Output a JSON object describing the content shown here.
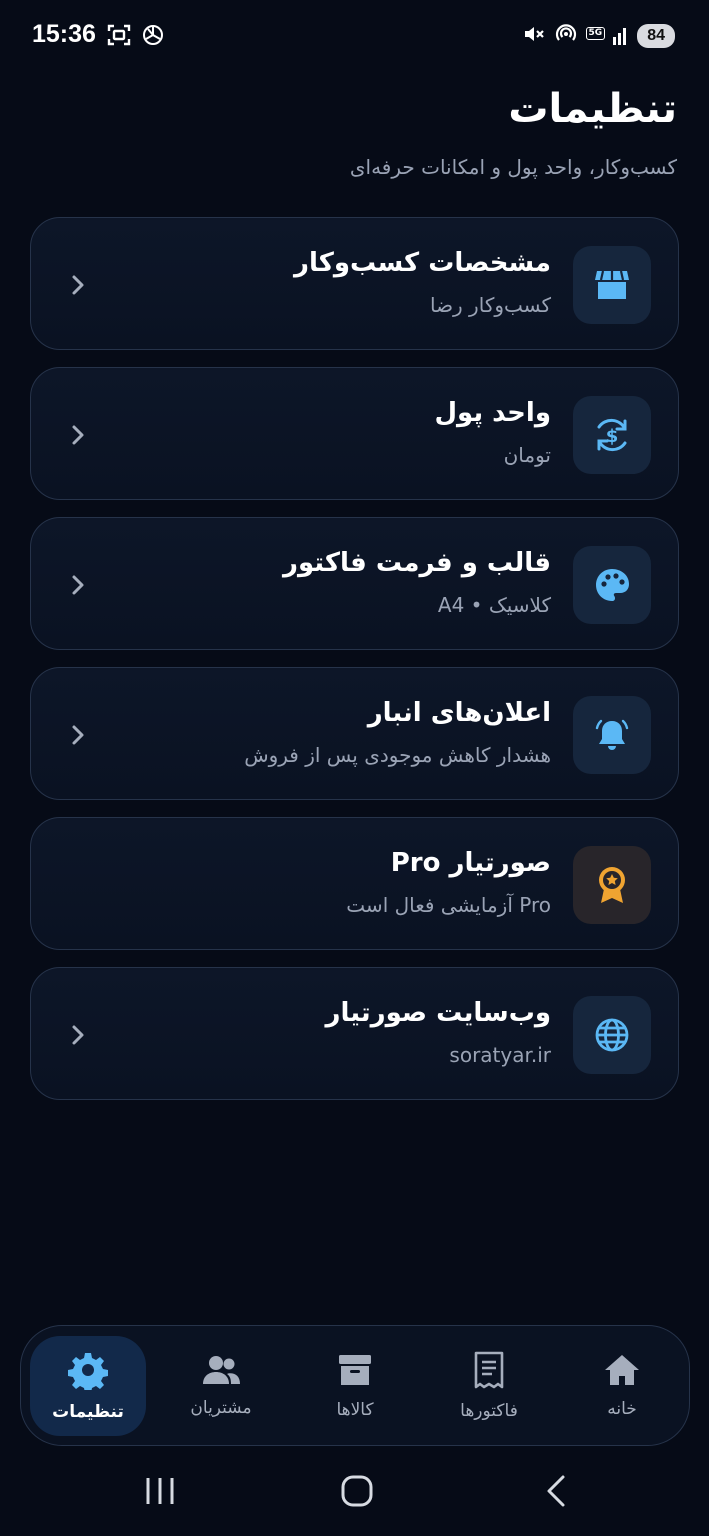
{
  "status_bar": {
    "time": "15:36",
    "battery": "84",
    "network": "5G",
    "icons": [
      "screenshot-icon",
      "chatgpt-icon",
      "mute-icon",
      "hotspot-icon",
      "signal-icon"
    ]
  },
  "header": {
    "title": "تنظیمات",
    "subtitle": "کسب‌وکار، واحد پول و امکانات حرفه‌ای"
  },
  "settings": [
    {
      "title": "مشخصات کسب‌وکار",
      "subtitle": "کسب‌وکار رضا",
      "icon": "store-icon"
    },
    {
      "title": "واحد پول",
      "subtitle": "تومان",
      "icon": "currency-exchange-icon"
    },
    {
      "title": "قالب و فرمت فاکتور",
      "subtitle": "کلاسیک • A4",
      "icon": "palette-icon"
    },
    {
      "title": "اعلان‌های انبار",
      "subtitle": "هشدار کاهش موجودی پس از فروش",
      "icon": "bell-icon"
    },
    {
      "title": "صورتیار Pro",
      "subtitle": "Pro آزمایشی فعال است",
      "icon": "award-icon"
    },
    {
      "title": "وب‌سایت صورتیار",
      "subtitle": "soratyar.ir",
      "icon": "globe-icon"
    }
  ],
  "bottom_nav": {
    "items": [
      {
        "label": "تنظیمات",
        "icon": "gear-icon",
        "active": true
      },
      {
        "label": "مشتریان",
        "icon": "users-icon",
        "active": false
      },
      {
        "label": "کالاها",
        "icon": "archive-box-icon",
        "active": false
      },
      {
        "label": "فاکتورها",
        "icon": "receipt-icon",
        "active": false
      },
      {
        "label": "خانه",
        "icon": "home-icon",
        "active": false
      }
    ]
  },
  "colors": {
    "background": "#060b17",
    "accent": "#5bb8f5",
    "gold": "#f0a431",
    "muted_text": "#9aa3b5",
    "card_border": "#26334a"
  }
}
